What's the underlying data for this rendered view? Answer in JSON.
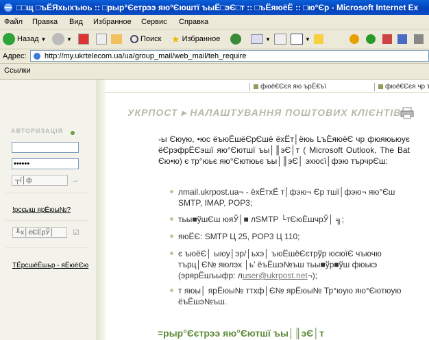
{
  "window": {
    "title": "□□щ □ъЁЯхыхъюь :: □рыр°Єетрээ яю°Єюштї ъыЁ□эЄ□т :: □ъЁяюёЁ :: □ю°Єр - Microsoft Internet Ex"
  },
  "menu": [
    "Файл",
    "Правка",
    "Вид",
    "Избранное",
    "Сервис",
    "Справка"
  ],
  "toolbar": {
    "back": "Назад",
    "search": "Поиск",
    "favorites": "Избранное"
  },
  "address": {
    "label": "Адрес:",
    "url": "http://my.ukrtelecom.ua/ua/group_mail/web_mail/teh_require"
  },
  "links": {
    "label": "Ссылки"
  },
  "tabs": [
    "фюё€Єєя яю ърЁ€ъї",
    "фюё€Єєя чр ъ"
  ],
  "left": {
    "auth_title": "АВТОРИЗАЦІЯ",
    "login_value": "",
    "password_value": "••••••",
    "enter_button": "┬ї│ф",
    "forgot_link": "!рсєыш ярЁюы№?",
    "register_button": "╨х│ёЄЁрЎ│",
    "services_link": "ТЁрсшёЁшьр - яЁюёЄю"
  },
  "page": {
    "heading": "УКРПОСТ ▸ НАЛАШТУВАННЯ ПОШТОВИХ КЛІЄНТІВ",
    "intro": "-ы Єюую, •юс ёъюЁшёЄрЄшё ёхЁт│ёюь LъЁяюёЄ чр фюяюьюує ёЄрэфрЁЄэшї яю°Єютшї ъы│║эЄ│т ( Microsoft Outlook, The Bat Єю•ю) є тр°юьє яю°Єютюьє ъы│║эЄ│ эхюсї│фэю търчрЄш:",
    "bullets": [
      {
        "text": "лmail.ukrpost.uа¬ - ёхЁтхЁ т│фэю¬ Єр тшї│фэю¬ яю°Єш SMTP, IMAP, POP3;"
      },
      {
        "text": "тьы■ўшЄш юяЎ│■ лSMTP └тЄюЁшчрЎ│ ╗;"
      },
      {
        "text": "яюЁЄ: SMTP Ц 25, POP3 Ц 110;"
      },
      {
        "text": "є ъюёЄ│ ыюу│эр/│ьхэ│ ъюЁшёЄєтрўр юсюїЄ чъючю търц│Є№ яюлэх │ь' ёъЁшэ№ъш тьы■ўр■ўш фюькэ (эрярЁшъыфр: л",
        "email": "user@ukrpost.net",
        "tail": "¬);"
      },
      {
        "text": "т яюы│ ярЁюы№ ттхф│Є№ ярЁюы№ Тр°юую яю°Єютюую ёъЁшэ№ъш."
      }
    ],
    "footer_heading": "=рыр°Єєтрээ яю°Єютшї ъы│║эЄ│т"
  }
}
